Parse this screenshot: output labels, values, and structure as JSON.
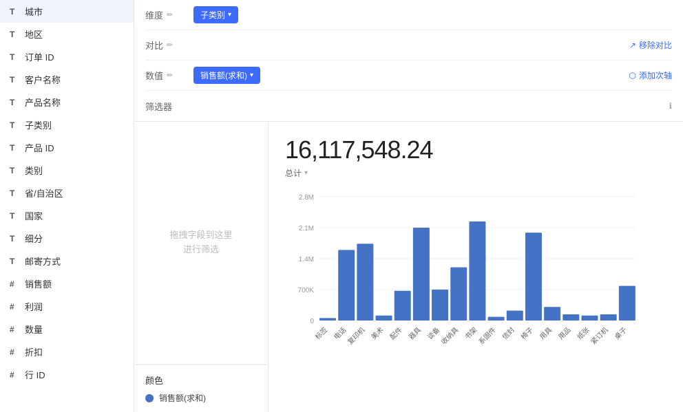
{
  "sidebar": {
    "items": [
      {
        "label": "城市",
        "type": "T"
      },
      {
        "label": "地区",
        "type": "T"
      },
      {
        "label": "订单 ID",
        "type": "T"
      },
      {
        "label": "客户名称",
        "type": "T"
      },
      {
        "label": "产品名称",
        "type": "T"
      },
      {
        "label": "子类别",
        "type": "T"
      },
      {
        "label": "产品 ID",
        "type": "T"
      },
      {
        "label": "类别",
        "type": "T"
      },
      {
        "label": "省/自治区",
        "type": "T"
      },
      {
        "label": "国家",
        "type": "T"
      },
      {
        "label": "细分",
        "type": "T"
      },
      {
        "label": "邮寄方式",
        "type": "T"
      },
      {
        "label": "销售额",
        "type": "#"
      },
      {
        "label": "利润",
        "type": "#"
      },
      {
        "label": "数量",
        "type": "#"
      },
      {
        "label": "折扣",
        "type": "#"
      },
      {
        "label": "行 ID",
        "type": "#"
      }
    ]
  },
  "controls": {
    "dimension_label": "维度",
    "dimension_tag": "子类别",
    "compare_label": "对比",
    "remove_compare": "移除对比",
    "value_label": "数值",
    "value_tag": "销售额(求和)",
    "add_secondary": "添加次轴",
    "filter_label": "筛选器",
    "filter_info_icon": "ℹ"
  },
  "filter": {
    "drop_zone_text": "拖拽字段到这里\n进行筛选"
  },
  "color_legend": {
    "header": "颜色",
    "items": [
      {
        "label": "销售额(求和)",
        "color": "#4472c4"
      }
    ]
  },
  "chart": {
    "total": "16,117,548.24",
    "subtitle": "总计",
    "y_labels": [
      "2.8M",
      "2.1M",
      "1.4M",
      "700K",
      "0"
    ],
    "bars": [
      {
        "label": "标签",
        "value": 50000,
        "height_pct": 2
      },
      {
        "label": "电话",
        "value": 1600000,
        "height_pct": 57
      },
      {
        "label": "复印机",
        "value": 1750000,
        "height_pct": 62
      },
      {
        "label": "美术",
        "value": 100000,
        "height_pct": 4
      },
      {
        "label": "配件",
        "value": 680000,
        "height_pct": 24
      },
      {
        "label": "器具",
        "value": 2120000,
        "height_pct": 75
      },
      {
        "label": "谈备",
        "value": 700000,
        "height_pct": 25
      },
      {
        "label": "收纳具",
        "value": 1200000,
        "height_pct": 43
      },
      {
        "label": "书架",
        "value": 2260000,
        "height_pct": 80
      },
      {
        "label": "系固件",
        "value": 90000,
        "height_pct": 3
      },
      {
        "label": "信封",
        "value": 220000,
        "height_pct": 8
      },
      {
        "label": "椅子",
        "value": 2000000,
        "height_pct": 71
      },
      {
        "label": "用具",
        "value": 310000,
        "height_pct": 11
      },
      {
        "label": "用品",
        "value": 150000,
        "height_pct": 5
      },
      {
        "label": "纸张",
        "value": 120000,
        "height_pct": 4
      },
      {
        "label": "紧订机",
        "value": 140000,
        "height_pct": 5
      },
      {
        "label": "桌子",
        "value": 780000,
        "height_pct": 28
      }
    ],
    "accent_color": "#4472c4"
  }
}
